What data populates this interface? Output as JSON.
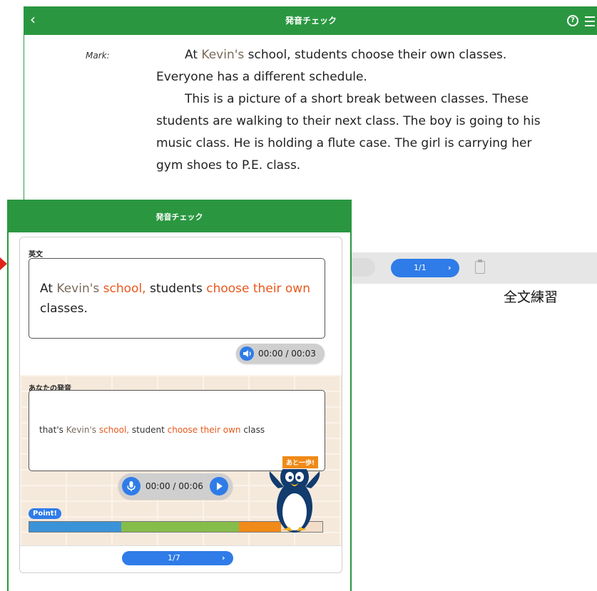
{
  "back_window": {
    "title": "発音チェック",
    "back_icon": "chevron-left-icon",
    "help_icon": "?",
    "menu_icon": "hamburger-icon",
    "speaker": "Mark:",
    "passage": {
      "p1_start": "At ",
      "p1_kevin": "Kevin's",
      "p1_rest": " school, students choose their own classes. Everyone has a different schedule.",
      "p2": "This is a picture of a short break between classes. These students are walking to their next class.  The boy is going to his music class.  He is holding a flute case.  The girl is carrying her gym shoes to P.E. class."
    },
    "pager": {
      "label": "1/1",
      "next": "›"
    },
    "clipboard_icon": "clipboard-icon"
  },
  "caption": "全文練習",
  "front_window": {
    "title": "発音チェック",
    "eibun_label": "英文",
    "eibun": {
      "w1": "At ",
      "w2": "Kevin's",
      "w3": " ",
      "w4": "school,",
      "w5": " students ",
      "w6": "choose their own",
      "w7": " classes."
    },
    "model_time": "00:00 / 00:03",
    "anata_label": "あなたの発音",
    "anata": {
      "w1": "that's ",
      "w2": "Kevin's",
      "w3": " ",
      "w4": "school,",
      "w5": " student ",
      "w6": "choose their own",
      "w7": " class"
    },
    "user_time": "00:00 / 00:06",
    "point_label": "Point!",
    "speech_badge": "あと一歩!",
    "score_segments": [
      {
        "fraction": 0.315,
        "color": "#3a93d8"
      },
      {
        "fraction": 0.4,
        "color": "#86bd4a"
      },
      {
        "fraction": 0.145,
        "color": "#f08a18"
      }
    ],
    "pager": {
      "label": "1/7",
      "next": "›"
    }
  },
  "colors": {
    "green": "#2a9740",
    "blue": "#2f7ce8",
    "highlight": "#e8581c",
    "arrow": "#e0241c"
  }
}
